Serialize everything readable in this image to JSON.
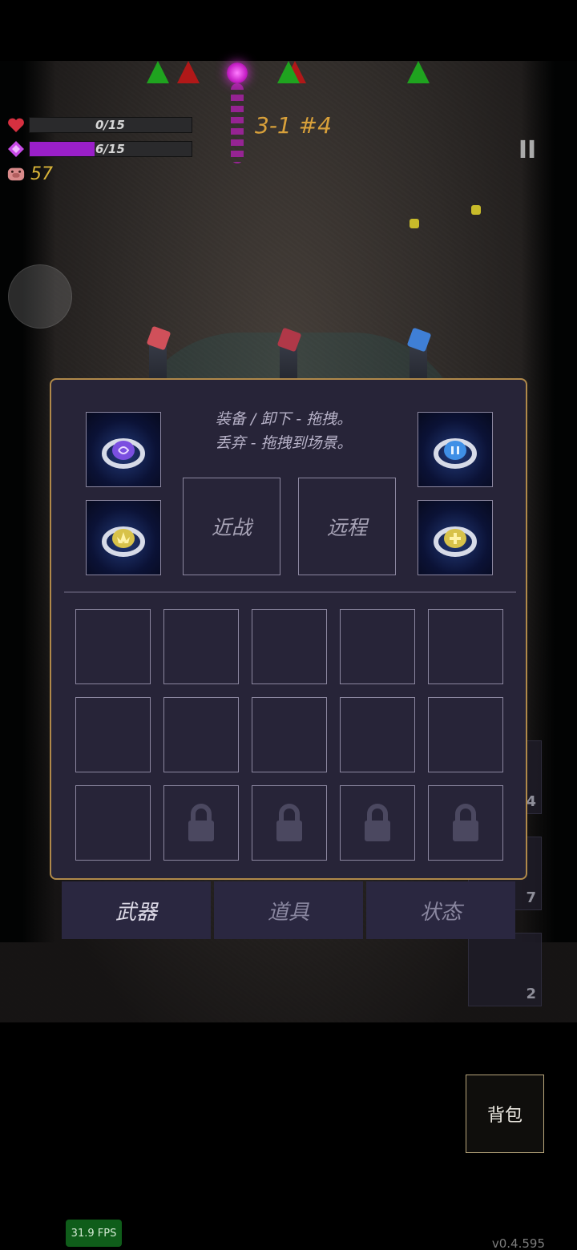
{
  "hud": {
    "health_text": "0/15",
    "health_fraction": 0.0,
    "mana_text": "6/15",
    "mana_fraction": 0.4,
    "coins": "57",
    "level": "3-1 #4",
    "pause_label": "II"
  },
  "inventory": {
    "hint_line1": "装备 / 卸下 - 拖拽。",
    "hint_line2": "丢弃 - 拖拽到场景。",
    "melee_label": "近战",
    "ranged_label": "远程",
    "rings": [
      {
        "name": "purple-swirl-ring",
        "gem_color": "#7b4fe0"
      },
      {
        "name": "blue-pause-ring",
        "gem_color": "#3f8fe6"
      },
      {
        "name": "gold-lotus-ring",
        "gem_color": "#d8c24a"
      },
      {
        "name": "gold-cross-ring",
        "gem_color": "#d8c24a"
      }
    ],
    "slot_count": 15,
    "locked_slots": [
      11,
      12,
      13,
      14
    ]
  },
  "tabs": [
    {
      "label": "武器",
      "active": true
    },
    {
      "label": "道具",
      "active": false
    },
    {
      "label": "状态",
      "active": false
    }
  ],
  "side_counts": [
    "4",
    "7",
    "2"
  ],
  "bag_label": "背包",
  "fps": "31.9 FPS",
  "version": "v0.4.595",
  "colors": {
    "panel_bg": "#272438",
    "panel_border": "#b0894a",
    "mana": "#9a1fc9",
    "coin": "#d8b338",
    "level": "#d8a03a"
  }
}
